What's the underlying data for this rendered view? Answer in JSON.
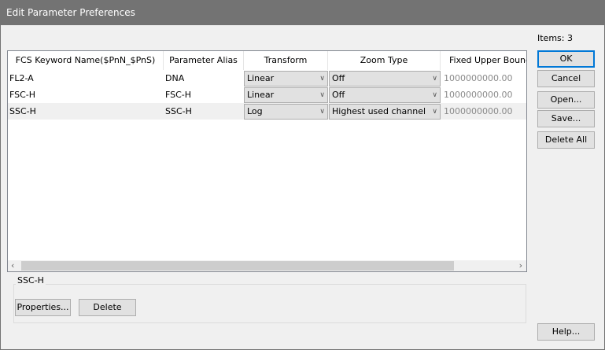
{
  "window": {
    "title": "Edit Parameter Preferences"
  },
  "items_count": "Items: 3",
  "table": {
    "columns": [
      "FCS Keyword Name($PnN_$PnS)",
      "Parameter Alias",
      "Transform",
      "Zoom Type",
      "Fixed Upper Bound"
    ],
    "rows": [
      {
        "keyword": "FL2-A",
        "alias": "DNA",
        "transform": "Linear",
        "zoom": "Off",
        "upper": "1000000000.00"
      },
      {
        "keyword": "FSC-H",
        "alias": "FSC-H",
        "transform": "Linear",
        "zoom": "Off",
        "upper": "1000000000.00"
      },
      {
        "keyword": "SSC-H",
        "alias": "SSC-H",
        "transform": "Log",
        "zoom": "Highest used channel",
        "upper": "1000000000.00"
      }
    ]
  },
  "buttons": {
    "ok": "OK",
    "cancel": "Cancel",
    "open": "Open...",
    "save": "Save...",
    "delete_all": "Delete All",
    "help": "Help...",
    "properties": "Properties...",
    "delete": "Delete"
  },
  "group": {
    "label": "SSC-H"
  },
  "scroll": {
    "left": "‹",
    "right": "›"
  }
}
